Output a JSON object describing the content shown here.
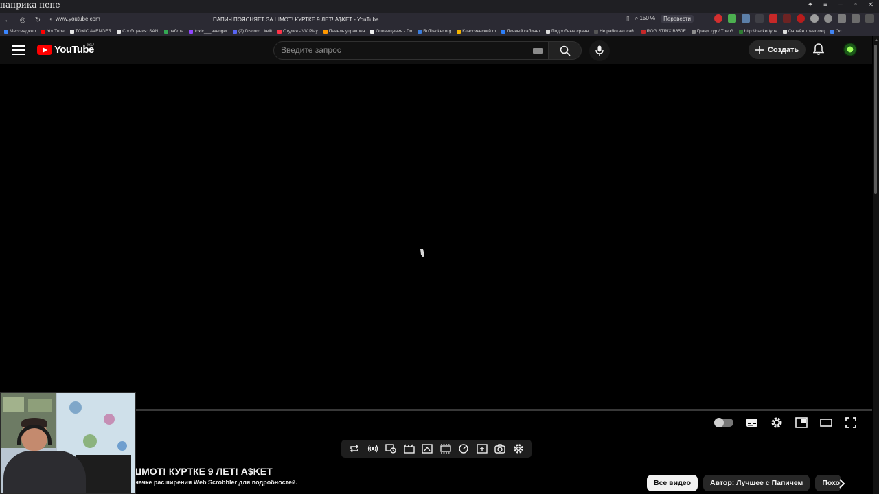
{
  "overlay_caption": "паприка пепе",
  "browser": {
    "url": "www.youtube.com",
    "tab_title": "ПАПИЧ ПОЯСНЯЕТ ЗА ШМОТ! КУРТКЕ 9 ЛЕТ! A$KET - YouTube",
    "zoom": "150 %",
    "translate_label": "Перевести",
    "bookmarks": [
      {
        "label": "Мессенджер",
        "color": "#3a86ff"
      },
      {
        "label": "YouTube",
        "color": "#ff0000"
      },
      {
        "label": "TOXIC AVENGER",
        "color": "#e6e6e6"
      },
      {
        "label": "Сообщения: SAN",
        "color": "#e6e6e6"
      },
      {
        "label": "работа",
        "color": "#34a853"
      },
      {
        "label": "toxic___avenger",
        "color": "#9146ff"
      },
      {
        "label": "(2) Discord | #elit",
        "color": "#5865f2"
      },
      {
        "label": "Студия - VK Play",
        "color": "#ff3347"
      },
      {
        "label": "Панель управлен",
        "color": "#ff9800"
      },
      {
        "label": "Оповещения - Do",
        "color": "#f0f0f0"
      },
      {
        "label": "RuTracker.org",
        "color": "#3b7ddd"
      },
      {
        "label": "Классический ф",
        "color": "#f5b400"
      },
      {
        "label": "Личный кабинет",
        "color": "#2d7ff9"
      },
      {
        "label": "Подробные сравн",
        "color": "#dcdcdc"
      },
      {
        "label": "Не работает сайт",
        "color": "#555555"
      },
      {
        "label": "ROG STRIX B650E",
        "color": "#c62828"
      },
      {
        "label": "Гранд тур / The G",
        "color": "#8e8e8e"
      },
      {
        "label": "http://hackertype",
        "color": "#2e7d32"
      },
      {
        "label": "Онлайн трансляц",
        "color": "#dddddd"
      },
      {
        "label": "Ос",
        "color": "#4285f4"
      }
    ]
  },
  "youtube": {
    "logo_text": "YouTube",
    "region": "RU",
    "search_placeholder": "Введите запрос",
    "create_label": "Создать"
  },
  "video": {
    "title_fragment": "ШМОТ! КУРТКЕ 9 ЛЕТ! A$KET",
    "scrobbler_note": "значке расширения Web Scrobbler для подробностей."
  },
  "chips": [
    {
      "label": "Все видео",
      "active": true
    },
    {
      "label": "Автор: Лучшее с Папичем",
      "active": false
    },
    {
      "label": "Похо",
      "active": false
    }
  ],
  "colors": {
    "youtube_red": "#ff0000",
    "page_bg": "#0f0f0f",
    "chip_bg": "#272727"
  }
}
